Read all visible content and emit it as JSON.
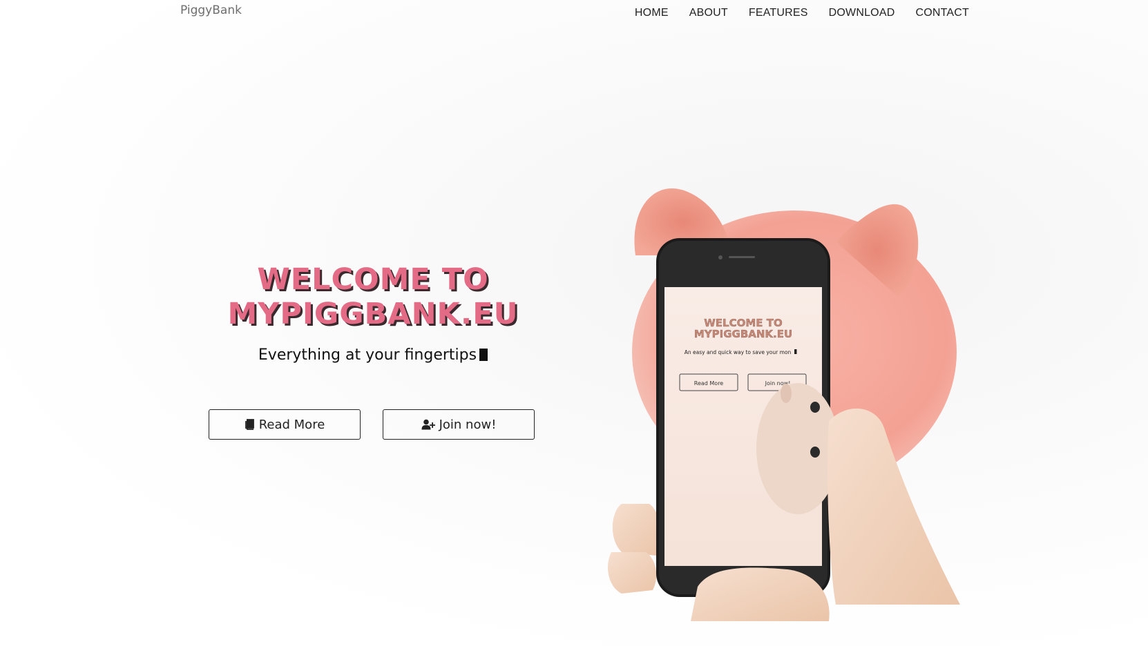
{
  "brand": "PiggyBank",
  "nav": {
    "items": [
      "HOME",
      "ABOUT",
      "FEATURES",
      "DOWNLOAD",
      "CONTACT"
    ]
  },
  "hero": {
    "title_line1": "WELCOME TO",
    "title_line2": "MYPIGGBANK.EU",
    "subtitle": "Everything at your fingertips",
    "read_more_label": "Read More",
    "join_label": "Join now!"
  },
  "phone_screen": {
    "title_line1": "WELCOME TO",
    "title_line2": "MYPIGGBANK.EU",
    "subtitle": "An easy and quick way to save your mon",
    "read_more_label": "Read More",
    "join_label": "Join now!"
  },
  "colors": {
    "accent_pink": "#e46b86",
    "title_shadow": "#3a2a2e",
    "piggy_pink": "#f5a59b"
  },
  "icons": {
    "read_more": "book-icon",
    "join": "user-plus-icon",
    "typing_cursor": "cursor-block"
  }
}
